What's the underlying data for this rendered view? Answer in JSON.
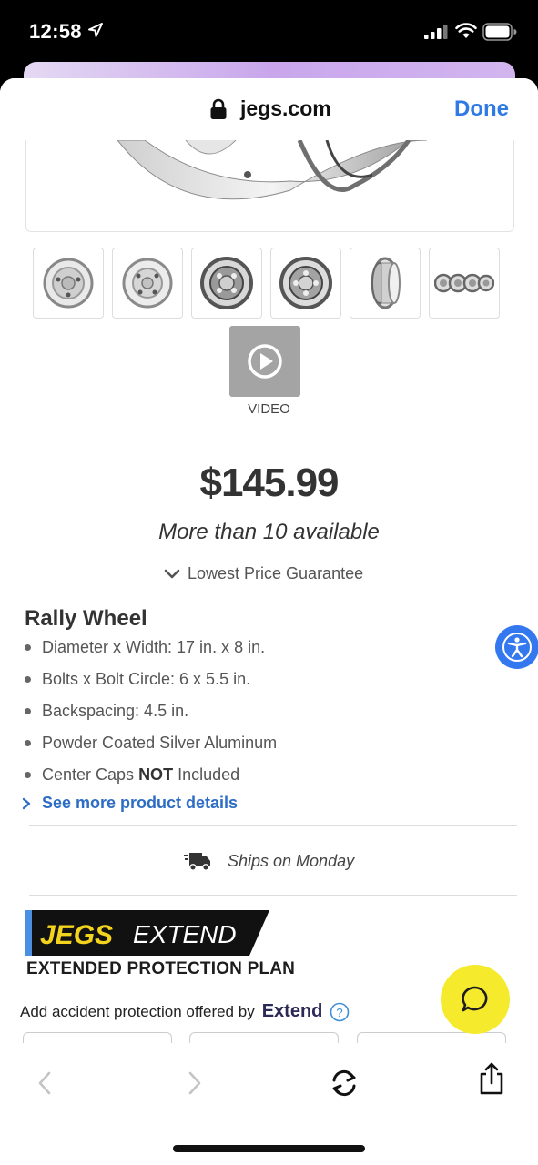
{
  "status": {
    "time": "12:58"
  },
  "browser": {
    "domain": "jegs.com",
    "done_label": "Done"
  },
  "media": {
    "video_label": "VIDEO",
    "thumbnails": [
      {
        "name": "wheel-front-view"
      },
      {
        "name": "wheel-angle-view"
      },
      {
        "name": "wheel-back-view"
      },
      {
        "name": "wheel-back-angle-view"
      },
      {
        "name": "wheel-side-view"
      },
      {
        "name": "wheel-set-view"
      }
    ]
  },
  "product": {
    "price": "$145.99",
    "availability": "More than 10 available",
    "guarantee": "Lowest Price Guarantee",
    "title": "Rally Wheel",
    "specs": [
      {
        "pre": "Diameter x Width: 17 in. x 8 in.",
        "bold": "",
        "post": ""
      },
      {
        "pre": "Bolts x Bolt Circle: 6 x 5.5 in.",
        "bold": "",
        "post": ""
      },
      {
        "pre": "Backspacing: 4.5 in.",
        "bold": "",
        "post": ""
      },
      {
        "pre": "Powder Coated Silver Aluminum",
        "bold": "",
        "post": ""
      },
      {
        "pre": "Center Caps ",
        "bold": "NOT",
        "post": " Included"
      }
    ],
    "see_more": "See more product details",
    "shipping": "Ships on Monday"
  },
  "extend": {
    "logo_text_1": "JEGS",
    "logo_text_2": "EXTEND",
    "plan_title": "EXTENDED PROTECTION PLAN",
    "accident_text": "Add accident protection offered by",
    "brand": "Extend"
  },
  "colors": {
    "link_blue": "#2d6dc5",
    "ios_blue": "#2f7ae5",
    "chat_yellow": "#f5ea2c",
    "accessibility_blue": "#3478f0",
    "extend_blue_stripe": "#4b8fe2",
    "extend_yellow": "#f3d31c"
  },
  "icons": {
    "lock": "lock-icon",
    "video": "play-circle-icon",
    "chevron": "chevron-down-icon",
    "link": "chevron-right-icon",
    "truck": "delivery-truck-icon",
    "help": "question-circle-icon",
    "accessibility": "accessibility-icon",
    "chat": "chat-bubble-icon",
    "back": "chevron-left-icon",
    "forward": "chevron-right-icon",
    "reload": "reload-icon",
    "share": "share-icon"
  }
}
